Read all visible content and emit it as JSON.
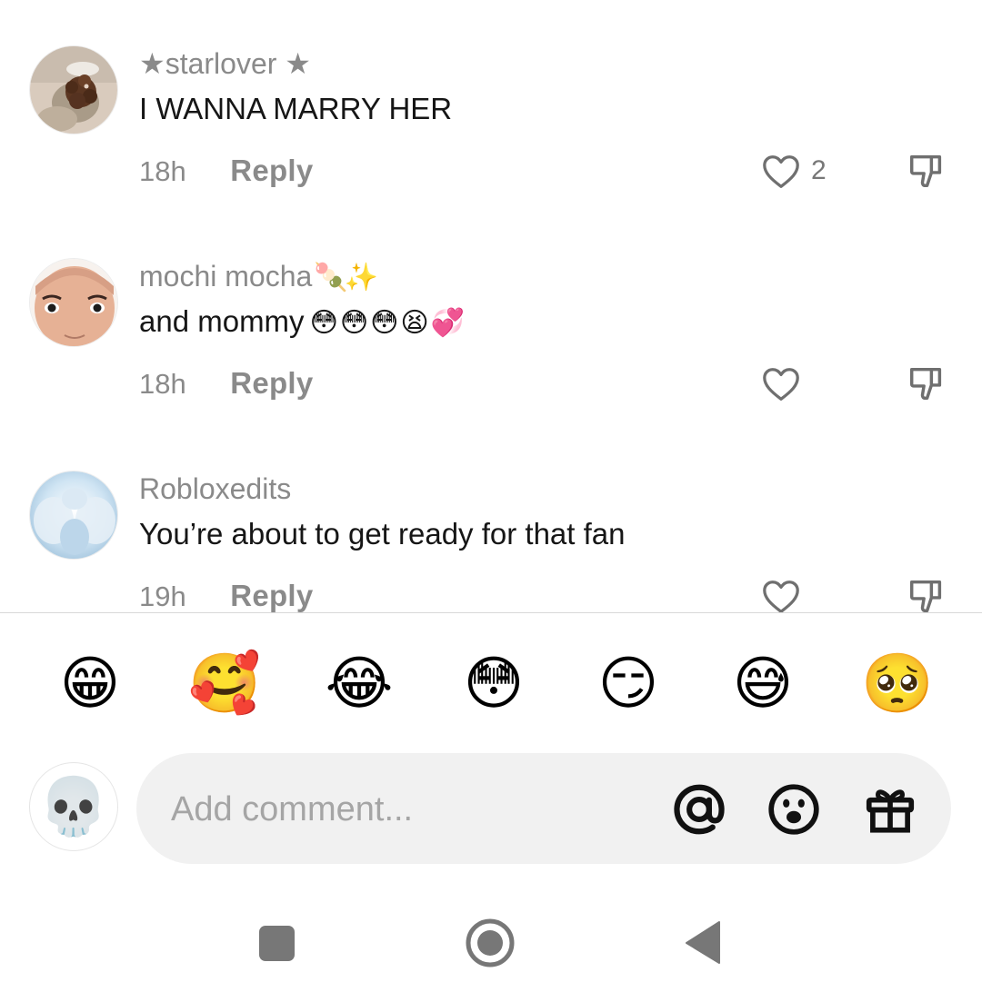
{
  "comments": [
    {
      "username": "★starlover ★",
      "text": "I WANNA MARRY HER",
      "time": "18h",
      "reply_label": "Reply",
      "like_count": "2",
      "avatar": "brown-teddy-photo"
    },
    {
      "username": "mochi mocha",
      "username_decoration": "🍡✨",
      "text": "and mommy",
      "text_emojis": "😳😳😳😫💞",
      "time": "18h",
      "reply_label": "Reply",
      "avatar": "roblox-face"
    },
    {
      "username": "Robloxedits",
      "text": "You’re about to get ready for that fan",
      "time": "19h",
      "reply_label": "Reply",
      "avatar": "blue-fairy-wings"
    }
  ],
  "quick_emojis": [
    "😁",
    "🥰",
    "😂",
    "😳",
    "😏",
    "😅",
    "🥺"
  ],
  "composer": {
    "avatar_emoji": "💀",
    "placeholder": "Add comment...",
    "icons": [
      "mention-icon",
      "emoji-icon",
      "gift-icon"
    ]
  },
  "nav": [
    "recents-icon",
    "home-icon",
    "back-icon"
  ],
  "colors": {
    "secondary_text": "#8a8a8a",
    "primary_text": "#161616",
    "input_bg": "#f1f1f1",
    "nav_icon": "#777777"
  }
}
